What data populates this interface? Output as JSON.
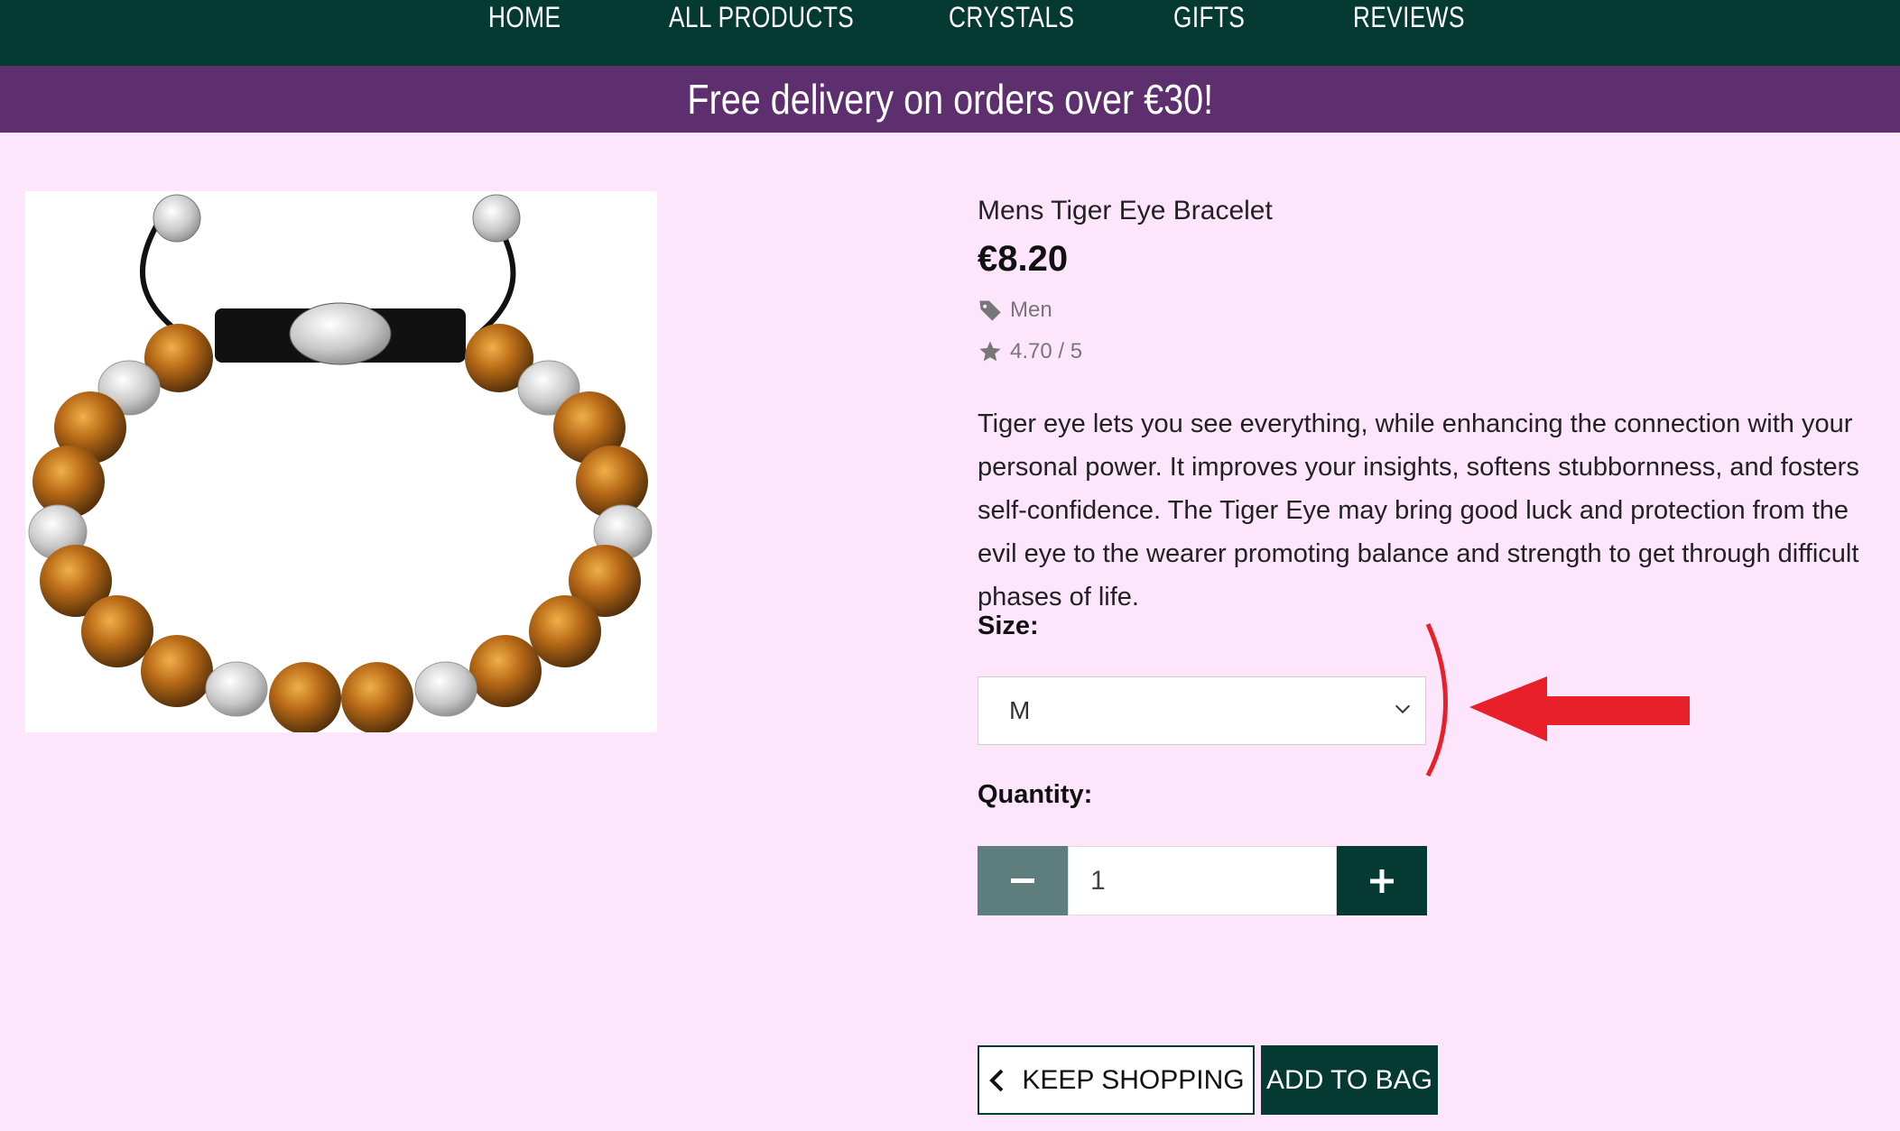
{
  "nav": {
    "items": [
      "HOME",
      "ALL PRODUCTS",
      "CRYSTALS",
      "GIFTS",
      "REVIEWS"
    ]
  },
  "banner": {
    "text": "Free delivery on orders over €30!"
  },
  "product": {
    "title": "Mens Tiger Eye Bracelet",
    "price": "€8.20",
    "category": "Men",
    "rating": "4.70 / 5",
    "description": "Tiger eye lets you see everything, while enhancing the connection with your personal power. It improves your insights, softens stubbornness, and fosters self-confidence. The Tiger Eye may bring good luck and protection from the evil eye to the wearer promoting balance and strength to get through difficult phases of life."
  },
  "size": {
    "label": "Size:",
    "selected": "M"
  },
  "quantity": {
    "label": "Quantity:",
    "value": "1"
  },
  "buttons": {
    "keep_shopping": "KEEP SHOPPING",
    "add_to_bag": "ADD TO BAG"
  },
  "colors": {
    "nav_bg": "#053a33",
    "banner_bg": "#5e2f6f",
    "page_bg": "#fde6fb",
    "annotation_red": "#e8202a"
  },
  "icons": {
    "category": "tag-icon",
    "rating": "star-icon",
    "select": "chevron-down-icon",
    "minus": "minus-icon",
    "plus": "plus-icon",
    "keep_shopping": "chevron-left-icon"
  }
}
